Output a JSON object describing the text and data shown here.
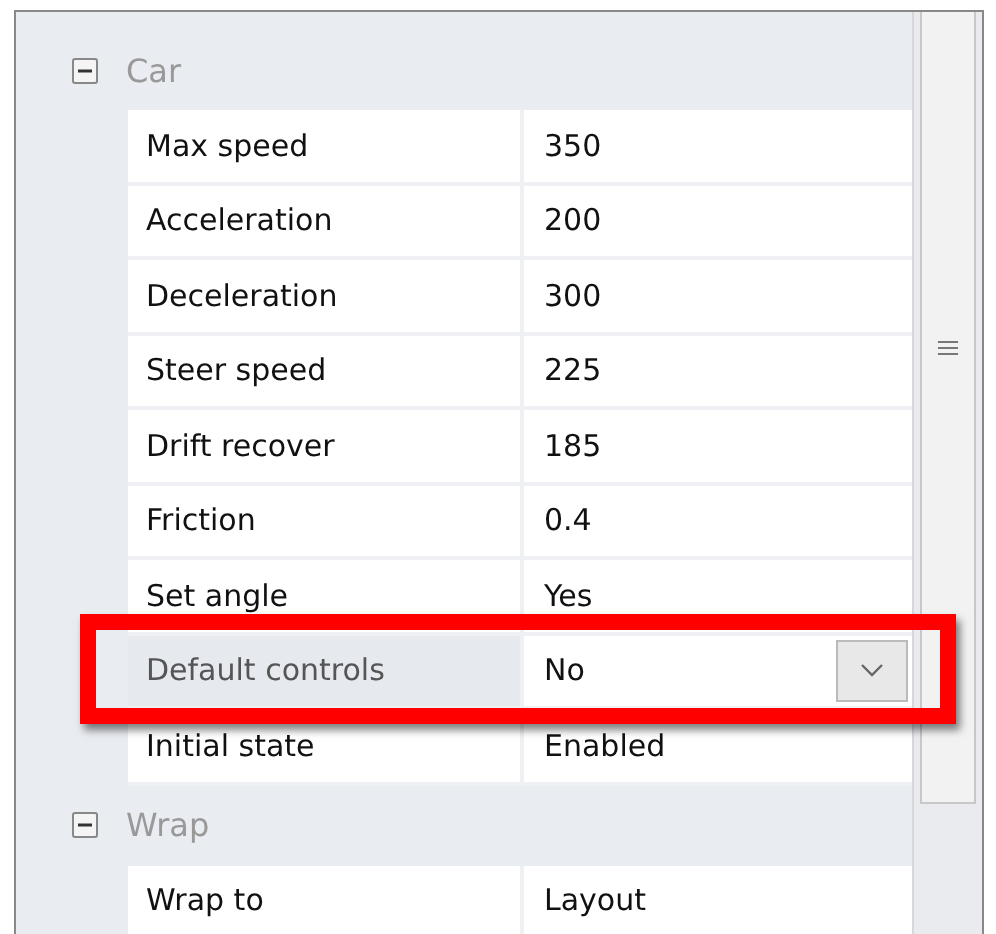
{
  "groups": [
    {
      "title": "Car",
      "expanded": true,
      "properties": [
        {
          "name": "Max speed",
          "value": "350",
          "kind": "text",
          "selected": false,
          "highlighted": false
        },
        {
          "name": "Acceleration",
          "value": "200",
          "kind": "text",
          "selected": false,
          "highlighted": false
        },
        {
          "name": "Deceleration",
          "value": "300",
          "kind": "text",
          "selected": false,
          "highlighted": false
        },
        {
          "name": "Steer speed",
          "value": "225",
          "kind": "text",
          "selected": false,
          "highlighted": false
        },
        {
          "name": "Drift recover",
          "value": "185",
          "kind": "text",
          "selected": false,
          "highlighted": false
        },
        {
          "name": "Friction",
          "value": "0.4",
          "kind": "text",
          "selected": false,
          "highlighted": false
        },
        {
          "name": "Set angle",
          "value": "Yes",
          "kind": "text",
          "selected": false,
          "highlighted": false
        },
        {
          "name": "Default controls",
          "value": "No",
          "kind": "dropdown",
          "selected": true,
          "highlighted": true
        },
        {
          "name": "Initial state",
          "value": "Enabled",
          "kind": "text",
          "selected": false,
          "highlighted": false
        }
      ]
    },
    {
      "title": "Wrap",
      "expanded": true,
      "properties": [
        {
          "name": "Wrap to",
          "value": "Layout",
          "kind": "text",
          "selected": false,
          "highlighted": false
        }
      ]
    }
  ]
}
